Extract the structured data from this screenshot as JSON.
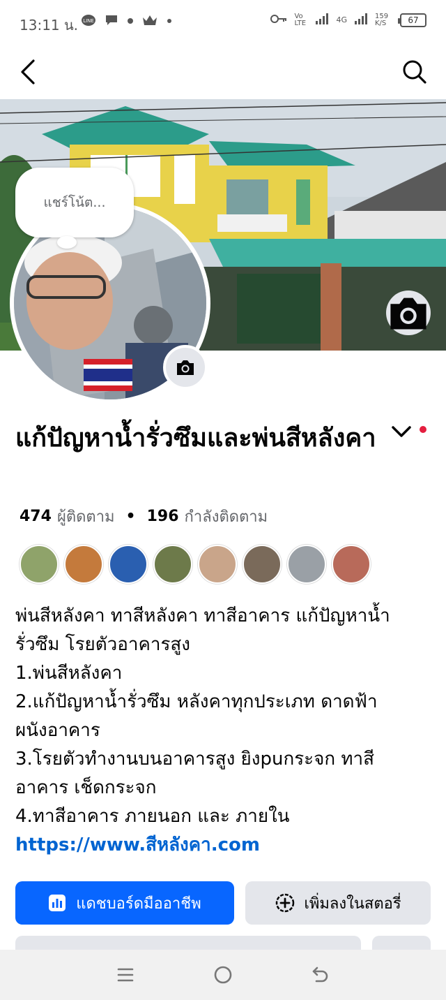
{
  "status_bar": {
    "time": "13:11 น.",
    "left_icons": [
      "line-icon",
      "chat-bubble-icon",
      "dot-icon",
      "crown-icon",
      "dot-icon"
    ],
    "network": "4G",
    "volte": "Vo LTE",
    "speed": "159 K/S",
    "battery": "67"
  },
  "nav": {
    "back_icon": "back-arrow-icon",
    "search_icon": "search-icon"
  },
  "note": {
    "placeholder": "แชร์โน้ต..."
  },
  "profile": {
    "name": "แก้ปัญหาน้ำรั่วซึมและพ่นสีหลังคา",
    "followers_count": "474",
    "followers_label": "ผู้ติดตาม",
    "following_count": "196",
    "following_label": "กำลังติดตาม",
    "separator": "•"
  },
  "friends": {
    "avatar_colors": [
      "#8fa36a",
      "#c47a3c",
      "#2a5fb0",
      "#6d7a4a",
      "#c9a58a",
      "#7a6a5a",
      "#9aa0a6",
      "#b86a5a"
    ]
  },
  "bio": {
    "lines": [
      "พ่นสีหลังคา ทาสีหลังคา ทาสีอาคาร แก้ปัญหาน้ำ",
      "รั่วซึม โรยตัวอาคารสูง",
      "1.พ่นสีหลังคา",
      "2.แก้ปัญหาน้ำรั่วซึม หลังคาทุกประเภท ดาดฟ้า",
      "ผนังอาคาร",
      "3.โรยตัวทำงานบนอาคารสูง ยิงpuกระจก ทาสี",
      "อาคาร เช็ดกระจก",
      "4.ทาสีอาคาร ภายนอก และ ภายใน"
    ],
    "link": "https://www.สีหลังคา.com"
  },
  "actions": {
    "dashboard_label": "แดชบอร์ดมืออาชีพ",
    "add_story_label": "เพิ่มลงในสตอรี่"
  },
  "colors": {
    "primary": "#0866ff",
    "secondary_bg": "#e4e6eb",
    "link": "#0064d1",
    "notification_dot": "#e41e3f"
  }
}
